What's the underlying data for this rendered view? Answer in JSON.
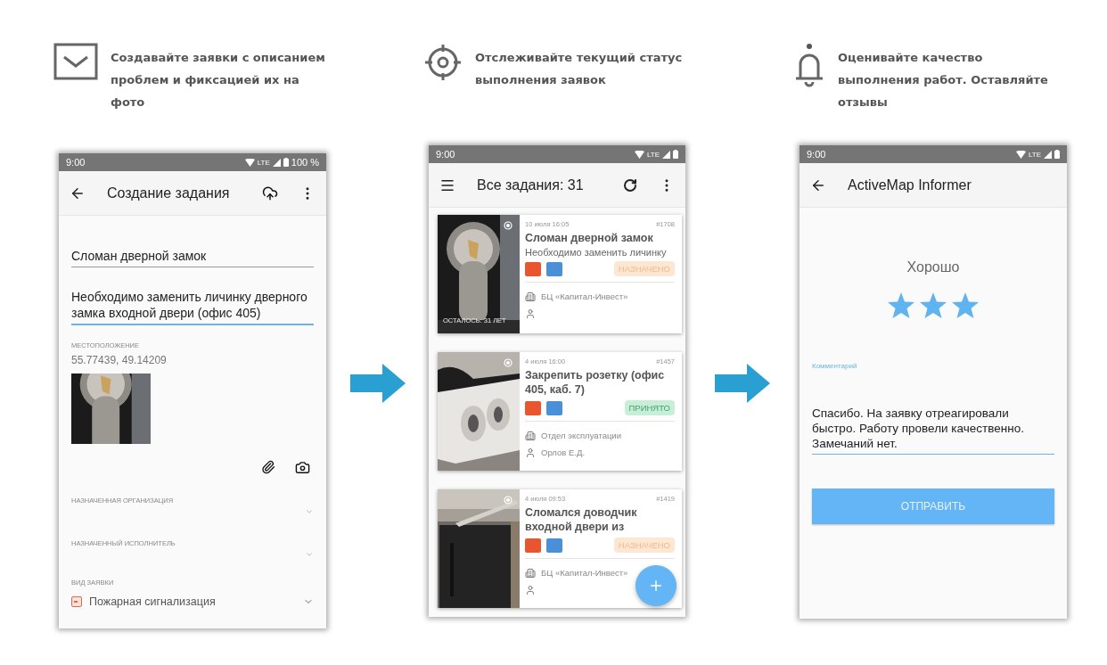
{
  "features": [
    {
      "kind": "envelope",
      "text": "Создавайте заявки с описанием проблем и фиксацией их на фото"
    },
    {
      "kind": "target",
      "text": "Отслеживайте текущий статус выполнения заявок"
    },
    {
      "kind": "bell",
      "text": "Оценивайте качество выполнения работ. Оставляйте отзывы"
    }
  ],
  "create_screen": {
    "status_bar": {
      "time": "9:00",
      "network": "LTE",
      "battery": "100 %"
    },
    "title": "Создание задания",
    "name_field": {
      "value": "Сломан дверной замок"
    },
    "description_field": {
      "value": "Необходимо заменить личинку дверного замка входной двери (офис 405)"
    },
    "location": {
      "label": "МЕСТОПОЛОЖЕНИЕ",
      "value": "55.77439, 49.14209"
    },
    "fields": [
      {
        "label": "НАЗНАЧЕННАЯ ОРГАНИЗАЦИЯ"
      },
      {
        "label": "НАЗНАЧЕННЫЙ ИСПОЛНИТЕЛЬ"
      }
    ],
    "type_field": {
      "label": "ВИД ЗАЯВКИ",
      "value": "Пожарная сигнализация"
    }
  },
  "list_screen": {
    "status_bar": {
      "time": "9:00",
      "network": "LTE"
    },
    "title": "Все задания: 31",
    "cards": [
      {
        "overlay": "ОСТАЛОСЬ: 31 ЛЕТ",
        "date": "10 июля 16:05",
        "number": "#1708",
        "title": "Сломан дверной замок",
        "subtitle": "Необходимо заменить личинку",
        "status": {
          "kind": "assigned",
          "label": "НАЗНАЧЕНО"
        },
        "organization": "БЦ «Капитал-Инвест»"
      },
      {
        "date": "4 июля 16:00",
        "number": "#1457",
        "title": "Закрепить розетку (офис 405, каб. 7)",
        "status": {
          "kind": "accepted",
          "label": "ПРИНЯТО"
        },
        "organization": "Отдел эксплуатации",
        "person": "Орлов Е.Д."
      },
      {
        "date": "4 июля 09:53",
        "number": "#1419",
        "title": "Сломался доводчик входной двери из",
        "status": {
          "kind": "assigned",
          "label": "НАЗНАЧЕНО"
        },
        "organization": "БЦ «Капитал-Инвест»"
      }
    ]
  },
  "rating_screen": {
    "status_bar": {
      "time": "9:00",
      "network": "LTE"
    },
    "title": "ActiveMap Informer",
    "rating_label": "Хорошо",
    "stars": 3,
    "comment": {
      "label": "Комментарий",
      "value": "Спасибо. На заявку отреагировали быстро. Работу провели качественно. Замечаний нет."
    },
    "button": "ОТПРАВИТЬ"
  }
}
